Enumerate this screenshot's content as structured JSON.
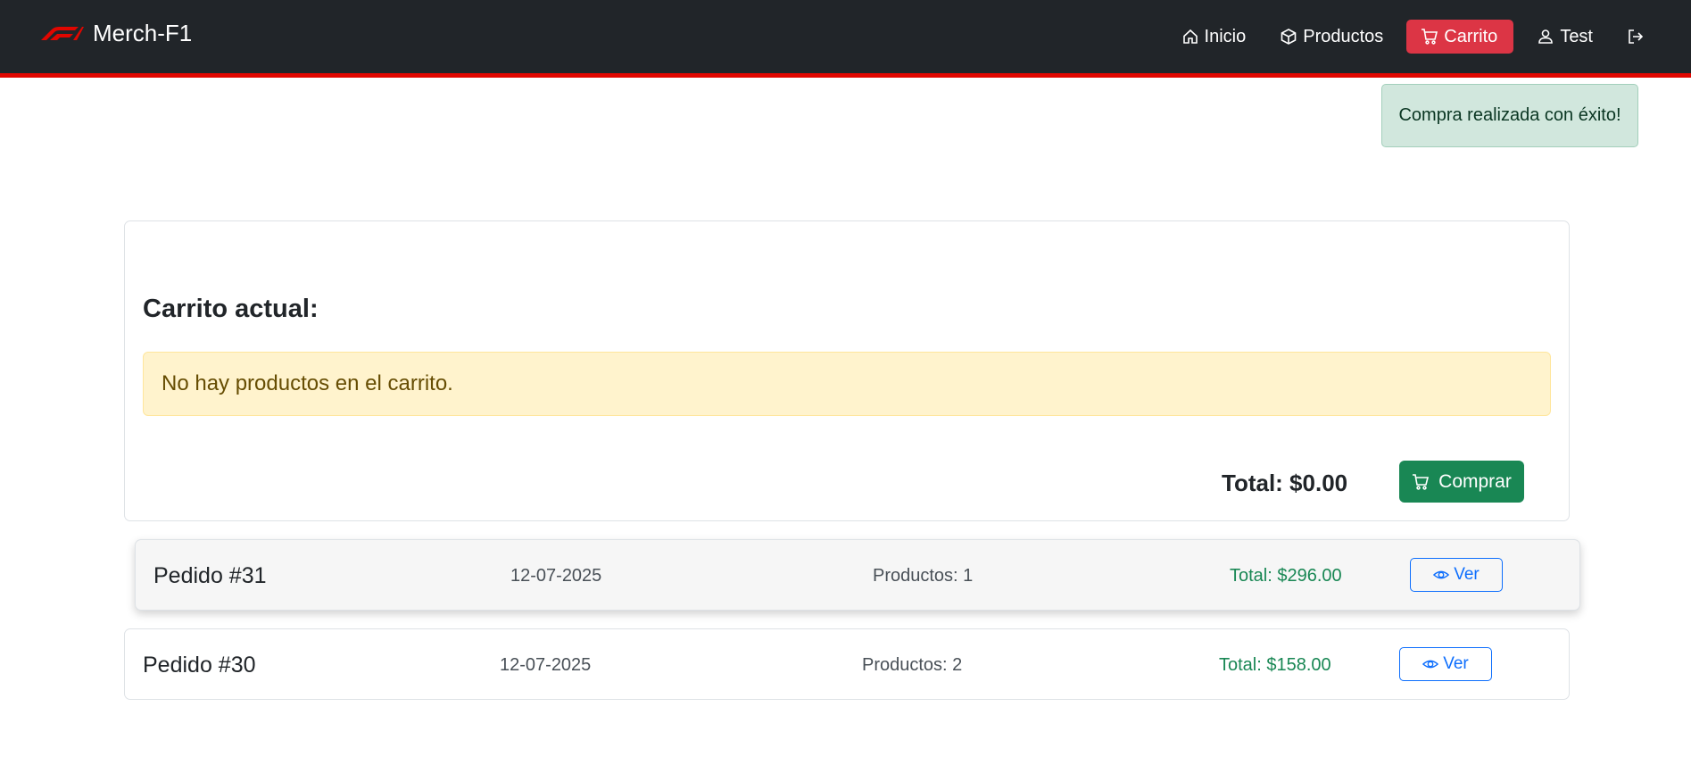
{
  "navbar": {
    "brand": "Merch-F1",
    "items": [
      {
        "label": "Inicio",
        "icon": "home-icon"
      },
      {
        "label": "Productos",
        "icon": "box-icon"
      },
      {
        "label": "Carrito",
        "icon": "cart-icon"
      },
      {
        "label": "Test",
        "icon": "user-icon"
      }
    ],
    "logout_icon": "logout-icon",
    "colors": {
      "background": "#212529",
      "accent": "#e10600",
      "active": "#dc3545"
    }
  },
  "toast": {
    "message": "Compra realizada con éxito!"
  },
  "cart": {
    "title": "Carrito actual:",
    "empty_message": "No hay productos en el carrito.",
    "total": "Total: $0.00",
    "buy_label": "Comprar"
  },
  "orders": [
    {
      "id": "Pedido #31",
      "date": "12-07-2025",
      "products": "Productos: 1",
      "total": "Total: $296.00",
      "view_label": "Ver"
    },
    {
      "id": "Pedido #30",
      "date": "12-07-2025",
      "products": "Productos: 2",
      "total": "Total: $158.00",
      "view_label": "Ver"
    }
  ]
}
